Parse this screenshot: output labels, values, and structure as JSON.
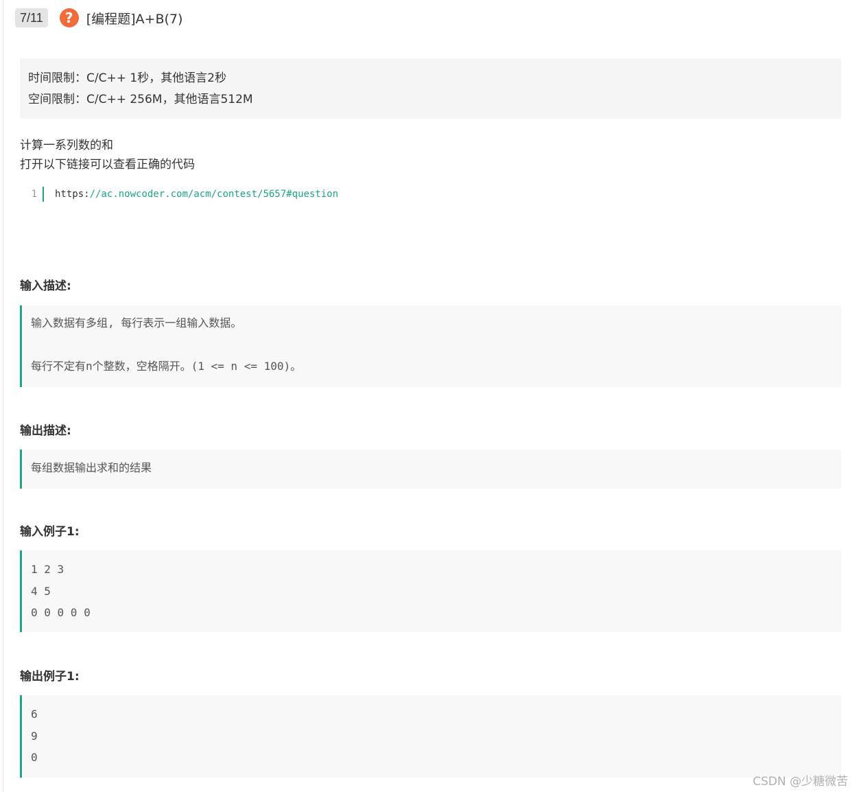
{
  "header": {
    "progress": "7/11",
    "help_icon": "question-circle-icon",
    "title": "[编程题]A+B(7)"
  },
  "limits": {
    "time": "时间限制：C/C++ 1秒，其他语言2秒",
    "space": "空间限制：C/C++ 256M，其他语言512M"
  },
  "description": {
    "line1": "计算一系列数的和",
    "line2": "打开以下链接可以查看正确的代码"
  },
  "code": {
    "line_number": "1",
    "scheme": "https:",
    "rest": "//ac.nowcoder.com/acm/contest/5657#question"
  },
  "input_desc": {
    "heading": "输入描述:",
    "lines": [
      "输入数据有多组, 每行表示一组输入数据。",
      "",
      "每行不定有n个整数，空格隔开。(1 <= n <= 100)。"
    ]
  },
  "output_desc": {
    "heading": "输出描述:",
    "lines": [
      "每组数据输出求和的结果"
    ]
  },
  "input_example": {
    "heading": "输入例子1:",
    "lines": [
      "1 2 3",
      "4 5",
      "0 0 0 0 0"
    ]
  },
  "output_example": {
    "heading": "输出例子1:",
    "lines": [
      "6",
      "9",
      "0"
    ]
  },
  "watermark": "CSDN @少糖微苦",
  "colors": {
    "accent": "#1ba784",
    "help_icon": "#f26b3a",
    "block_bg": "#f8f8f8",
    "limits_bg": "#f5f5f5"
  }
}
